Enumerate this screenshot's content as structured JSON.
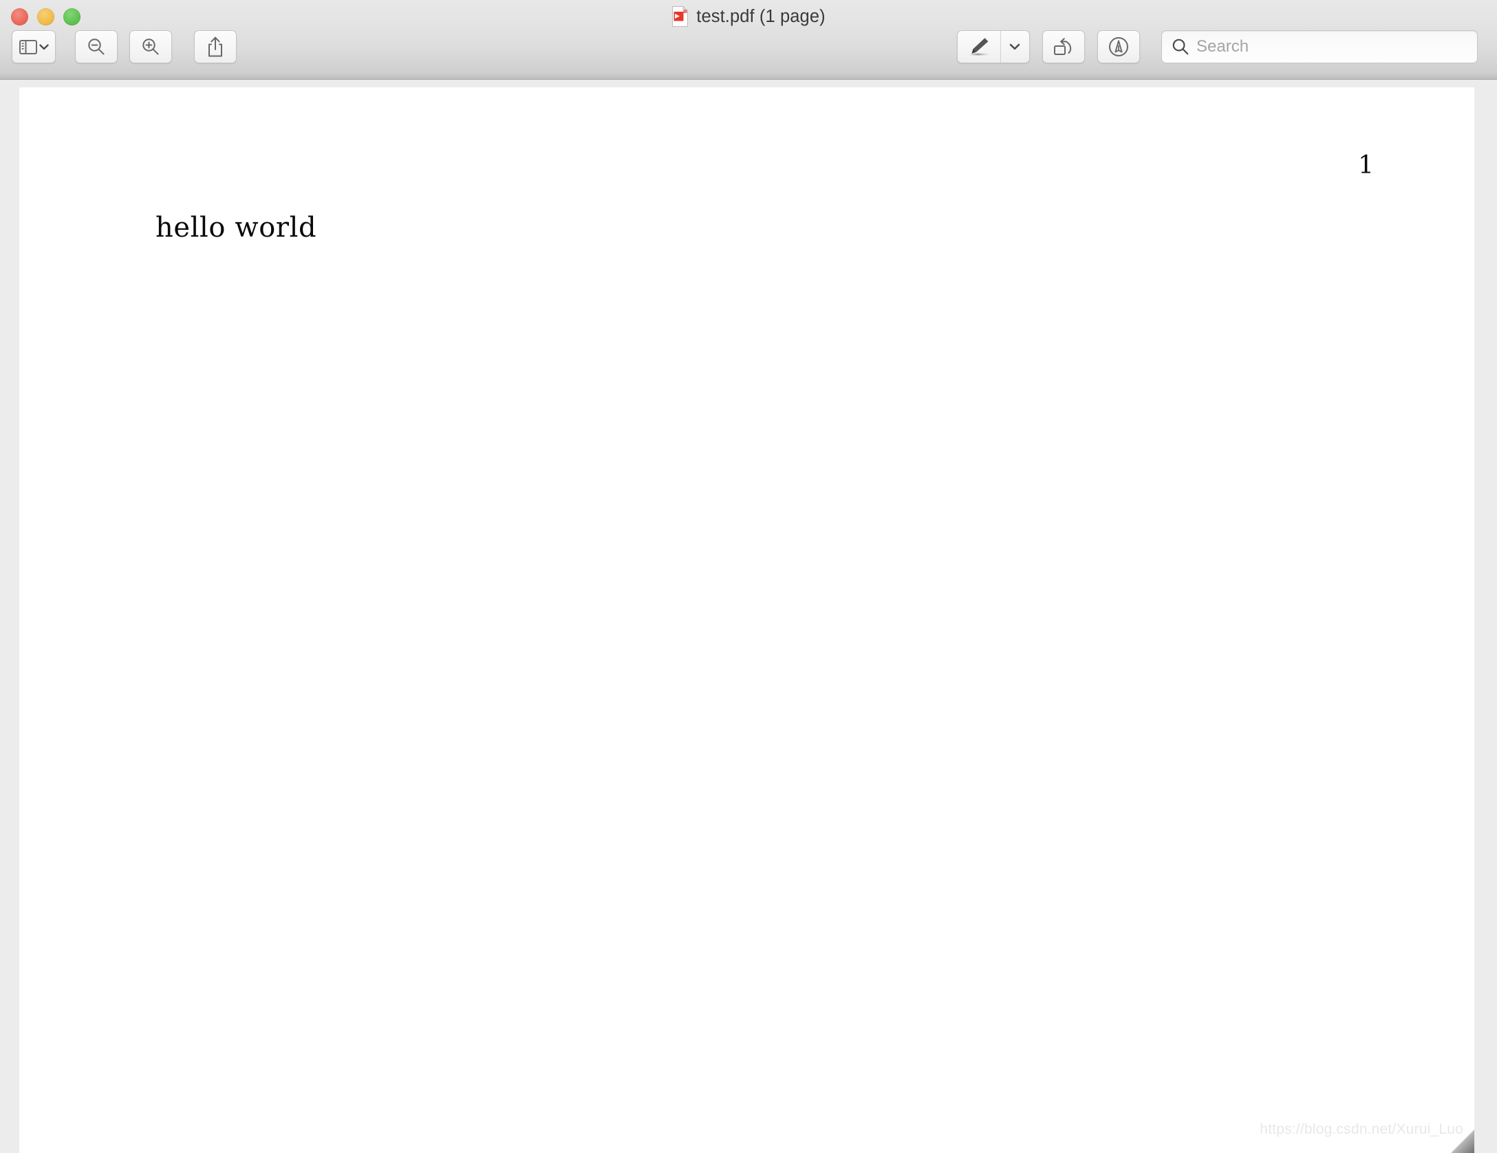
{
  "window": {
    "title": "test.pdf (1 page)",
    "file_icon": "pdf-file-icon",
    "traffic_lights": [
      {
        "name": "close",
        "color": "#ec6b5e"
      },
      {
        "name": "minimize",
        "color": "#f3bd4f"
      },
      {
        "name": "maximize",
        "color": "#61c554"
      }
    ]
  },
  "toolbar": {
    "sidebar_toggle": {
      "icon": "sidebar-panel-icon",
      "chevron": "chevron-down-icon",
      "label": ""
    },
    "zoom_out": {
      "icon": "magnifier-minus-icon",
      "label": ""
    },
    "zoom_in": {
      "icon": "magnifier-plus-icon",
      "label": ""
    },
    "share": {
      "icon": "share-icon",
      "label": ""
    },
    "markup_highlight": {
      "icon": "highlighter-pen-icon",
      "chevron": "chevron-down-icon",
      "label": ""
    },
    "rotate_left": {
      "icon": "rotate-left-icon",
      "label": ""
    },
    "markup_toolbar": {
      "icon": "pen-nib-circle-icon",
      "label": ""
    }
  },
  "search": {
    "icon": "search-icon",
    "placeholder": "Search",
    "value": ""
  },
  "document": {
    "page_number": "1",
    "body_text": "hello world",
    "watermark": "https://blog.csdn.net/Xurui_Luo"
  },
  "colors": {
    "toolbar_top": "#e8e8e8",
    "toolbar_bottom": "#bdbdbd",
    "canvas": "#ececec",
    "page": "#ffffff",
    "text": "#0a0a0a"
  }
}
